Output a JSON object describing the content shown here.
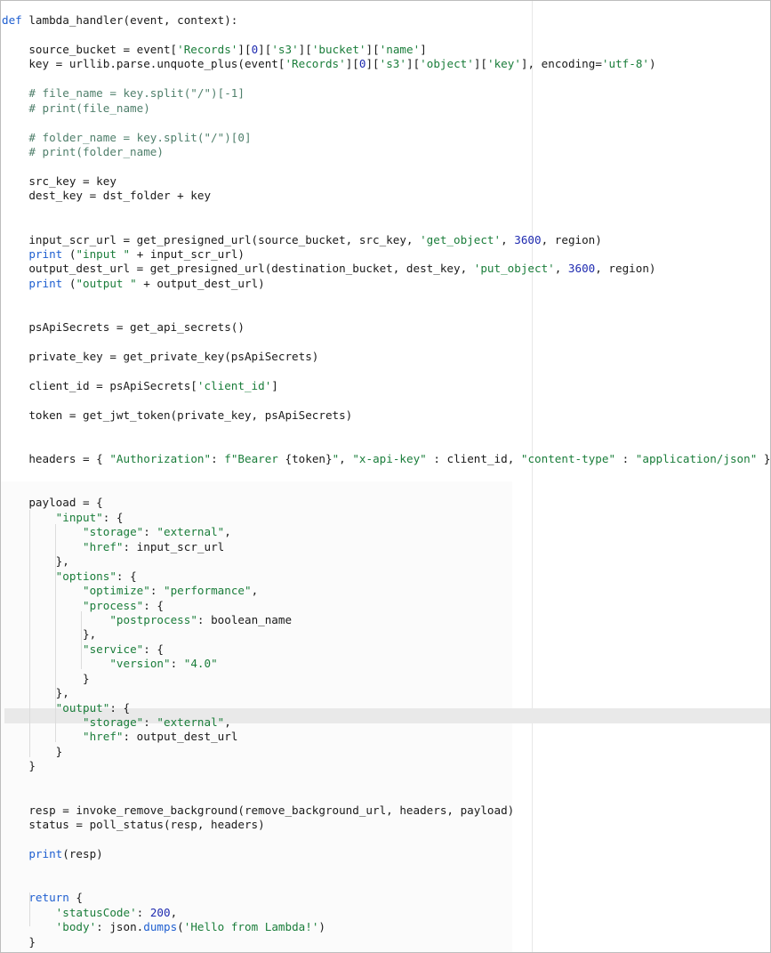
{
  "editor": {
    "language": "python",
    "colors": {
      "keyword": "#1f5fd0",
      "string": "#1a7d3a",
      "number": "#1f2bb0",
      "comment": "#4f7f6b",
      "text": "#1a1a1a",
      "highlight_row": "#e9e9e9"
    },
    "highlighted_line": 49,
    "lines": [
      [
        {
          "t": "kw",
          "v": "def"
        },
        {
          "t": "p",
          "v": " lambda_handler(event, context):"
        }
      ],
      [],
      [
        {
          "t": "p",
          "v": "    source_bucket = event["
        },
        {
          "t": "str",
          "v": "'Records'"
        },
        {
          "t": "p",
          "v": "]["
        },
        {
          "t": "num",
          "v": "0"
        },
        {
          "t": "p",
          "v": "]["
        },
        {
          "t": "str",
          "v": "'s3'"
        },
        {
          "t": "p",
          "v": "]["
        },
        {
          "t": "str",
          "v": "'bucket'"
        },
        {
          "t": "p",
          "v": "]["
        },
        {
          "t": "str",
          "v": "'name'"
        },
        {
          "t": "p",
          "v": "]"
        }
      ],
      [
        {
          "t": "p",
          "v": "    key = urllib.parse.unquote_plus(event["
        },
        {
          "t": "str",
          "v": "'Records'"
        },
        {
          "t": "p",
          "v": "]["
        },
        {
          "t": "num",
          "v": "0"
        },
        {
          "t": "p",
          "v": "]["
        },
        {
          "t": "str",
          "v": "'s3'"
        },
        {
          "t": "p",
          "v": "]["
        },
        {
          "t": "str",
          "v": "'object'"
        },
        {
          "t": "p",
          "v": "]["
        },
        {
          "t": "str",
          "v": "'key'"
        },
        {
          "t": "p",
          "v": "], encoding="
        },
        {
          "t": "str",
          "v": "'utf-8'"
        },
        {
          "t": "p",
          "v": ")"
        }
      ],
      [],
      [
        {
          "t": "cm",
          "v": "    # file_name = key.split(\"/\")[-1]"
        }
      ],
      [
        {
          "t": "cm",
          "v": "    # print(file_name)"
        }
      ],
      [],
      [
        {
          "t": "cm",
          "v": "    # folder_name = key.split(\"/\")[0]"
        }
      ],
      [
        {
          "t": "cm",
          "v": "    # print(folder_name)"
        }
      ],
      [],
      [
        {
          "t": "p",
          "v": "    src_key = key"
        }
      ],
      [
        {
          "t": "p",
          "v": "    dest_key = dst_folder + key"
        }
      ],
      [],
      [],
      [
        {
          "t": "p",
          "v": "    input_scr_url = get_presigned_url(source_bucket, src_key, "
        },
        {
          "t": "str",
          "v": "'get_object'"
        },
        {
          "t": "p",
          "v": ", "
        },
        {
          "t": "num",
          "v": "3600"
        },
        {
          "t": "p",
          "v": ", region)"
        }
      ],
      [
        {
          "t": "p",
          "v": "    "
        },
        {
          "t": "kw",
          "v": "print"
        },
        {
          "t": "p",
          "v": " ("
        },
        {
          "t": "str",
          "v": "\"input \""
        },
        {
          "t": "p",
          "v": " + input_scr_url)"
        }
      ],
      [
        {
          "t": "p",
          "v": "    output_dest_url = get_presigned_url(destination_bucket, dest_key, "
        },
        {
          "t": "str",
          "v": "'put_object'"
        },
        {
          "t": "p",
          "v": ", "
        },
        {
          "t": "num",
          "v": "3600"
        },
        {
          "t": "p",
          "v": ", region)"
        }
      ],
      [
        {
          "t": "p",
          "v": "    "
        },
        {
          "t": "kw",
          "v": "print"
        },
        {
          "t": "p",
          "v": " ("
        },
        {
          "t": "str",
          "v": "\"output \""
        },
        {
          "t": "p",
          "v": " + output_dest_url)"
        }
      ],
      [],
      [],
      [
        {
          "t": "p",
          "v": "    psApiSecrets = get_api_secrets()"
        }
      ],
      [],
      [
        {
          "t": "p",
          "v": "    private_key = get_private_key(psApiSecrets)"
        }
      ],
      [],
      [
        {
          "t": "p",
          "v": "    client_id = psApiSecrets["
        },
        {
          "t": "str",
          "v": "'client_id'"
        },
        {
          "t": "p",
          "v": "]"
        }
      ],
      [],
      [
        {
          "t": "p",
          "v": "    token = get_jwt_token(private_key, psApiSecrets)"
        }
      ],
      [],
      [],
      [
        {
          "t": "p",
          "v": "    headers = { "
        },
        {
          "t": "str",
          "v": "\"Authorization\""
        },
        {
          "t": "p",
          "v": ": "
        },
        {
          "t": "str",
          "v": "f\"Bearer "
        },
        {
          "t": "p",
          "v": "{token}"
        },
        {
          "t": "str",
          "v": "\""
        },
        {
          "t": "p",
          "v": ", "
        },
        {
          "t": "str",
          "v": "\"x-api-key\""
        },
        {
          "t": "p",
          "v": " : client_id, "
        },
        {
          "t": "str",
          "v": "\"content-type\""
        },
        {
          "t": "p",
          "v": " : "
        },
        {
          "t": "str",
          "v": "\"application/json\""
        },
        {
          "t": "p",
          "v": " }"
        }
      ],
      [],
      [],
      [
        {
          "t": "p",
          "v": "    payload = {"
        }
      ],
      [
        {
          "t": "p",
          "v": "        "
        },
        {
          "t": "str",
          "v": "\"input\""
        },
        {
          "t": "p",
          "v": ": {"
        }
      ],
      [
        {
          "t": "p",
          "v": "            "
        },
        {
          "t": "str",
          "v": "\"storage\""
        },
        {
          "t": "p",
          "v": ": "
        },
        {
          "t": "str",
          "v": "\"external\""
        },
        {
          "t": "p",
          "v": ","
        }
      ],
      [
        {
          "t": "p",
          "v": "            "
        },
        {
          "t": "str",
          "v": "\"href\""
        },
        {
          "t": "p",
          "v": ": input_scr_url"
        }
      ],
      [
        {
          "t": "p",
          "v": "        },"
        }
      ],
      [
        {
          "t": "p",
          "v": "        "
        },
        {
          "t": "str",
          "v": "\"options\""
        },
        {
          "t": "p",
          "v": ": {"
        }
      ],
      [
        {
          "t": "p",
          "v": "            "
        },
        {
          "t": "str",
          "v": "\"optimize\""
        },
        {
          "t": "p",
          "v": ": "
        },
        {
          "t": "str",
          "v": "\"performance\""
        },
        {
          "t": "p",
          "v": ","
        }
      ],
      [
        {
          "t": "p",
          "v": "            "
        },
        {
          "t": "str",
          "v": "\"process\""
        },
        {
          "t": "p",
          "v": ": {"
        }
      ],
      [
        {
          "t": "p",
          "v": "                "
        },
        {
          "t": "str",
          "v": "\"postprocess\""
        },
        {
          "t": "p",
          "v": ": boolean_name"
        }
      ],
      [
        {
          "t": "p",
          "v": "            },"
        }
      ],
      [
        {
          "t": "p",
          "v": "            "
        },
        {
          "t": "str",
          "v": "\"service\""
        },
        {
          "t": "p",
          "v": ": {"
        }
      ],
      [
        {
          "t": "p",
          "v": "                "
        },
        {
          "t": "str",
          "v": "\"version\""
        },
        {
          "t": "p",
          "v": ": "
        },
        {
          "t": "str",
          "v": "\"4.0\""
        }
      ],
      [
        {
          "t": "p",
          "v": "            }"
        }
      ],
      [
        {
          "t": "p",
          "v": "        },"
        }
      ],
      [
        {
          "t": "p",
          "v": "        "
        },
        {
          "t": "str",
          "v": "\"output\""
        },
        {
          "t": "p",
          "v": ": {"
        }
      ],
      [
        {
          "t": "p",
          "v": "            "
        },
        {
          "t": "str",
          "v": "\"storage\""
        },
        {
          "t": "p",
          "v": ": "
        },
        {
          "t": "str",
          "v": "\"external\""
        },
        {
          "t": "p",
          "v": ","
        }
      ],
      [
        {
          "t": "p",
          "v": "            "
        },
        {
          "t": "str",
          "v": "\"href\""
        },
        {
          "t": "p",
          "v": ": output_dest_url"
        }
      ],
      [
        {
          "t": "p",
          "v": "        }"
        }
      ],
      [
        {
          "t": "p",
          "v": "    }"
        }
      ],
      [],
      [],
      [
        {
          "t": "p",
          "v": "    resp = invoke_remove_background(remove_background_url, headers, payload)"
        }
      ],
      [
        {
          "t": "p",
          "v": "    status = poll_status(resp, headers)"
        }
      ],
      [],
      [
        {
          "t": "p",
          "v": "    "
        },
        {
          "t": "kw",
          "v": "print"
        },
        {
          "t": "p",
          "v": "(resp)"
        }
      ],
      [],
      [],
      [
        {
          "t": "p",
          "v": "    "
        },
        {
          "t": "kw",
          "v": "return"
        },
        {
          "t": "p",
          "v": " {"
        }
      ],
      [
        {
          "t": "p",
          "v": "        "
        },
        {
          "t": "str",
          "v": "'statusCode'"
        },
        {
          "t": "p",
          "v": ": "
        },
        {
          "t": "num",
          "v": "200"
        },
        {
          "t": "p",
          "v": ","
        }
      ],
      [
        {
          "t": "p",
          "v": "        "
        },
        {
          "t": "str",
          "v": "'body'"
        },
        {
          "t": "p",
          "v": ": json."
        },
        {
          "t": "bi",
          "v": "dumps"
        },
        {
          "t": "p",
          "v": "("
        },
        {
          "t": "str",
          "v": "'Hello from Lambda!'"
        },
        {
          "t": "p",
          "v": ")"
        }
      ],
      [
        {
          "t": "p",
          "v": "    }"
        }
      ]
    ]
  }
}
